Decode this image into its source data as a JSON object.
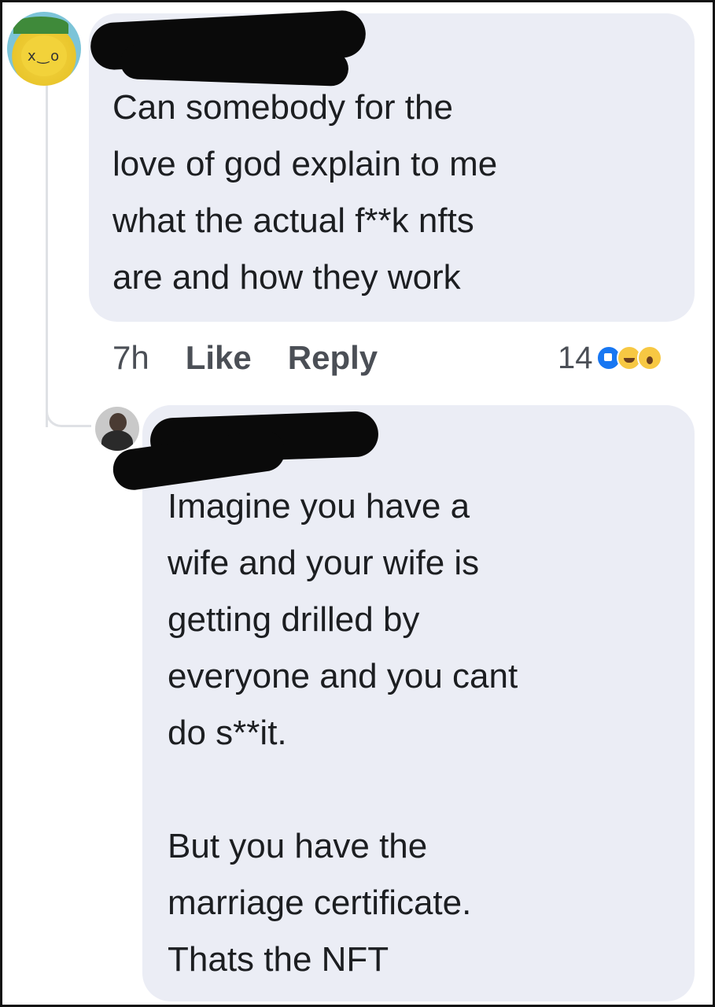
{
  "comments": [
    {
      "text": "Can somebody for the\nlove of god explain to me\nwhat the actual f**k nfts\nare and how they work",
      "time": "7h",
      "like_label": "Like",
      "reply_label": "Reply",
      "reaction_count": "14",
      "reactions": [
        "like-icon",
        "haha-icon",
        "wow-icon"
      ]
    },
    {
      "text": "Imagine you have a\nwife and your wife is\ngetting drilled by\neveryone and you cant\ndo s**it.\n\nBut you have the\nmarriage certificate.\nThats the NFT"
    }
  ],
  "colors": {
    "bubble": "#ebedf5",
    "text": "#1c1e21",
    "meta": "#4b4f56",
    "like_reaction": "#1877f2",
    "emoji_reaction": "#f7c843"
  }
}
